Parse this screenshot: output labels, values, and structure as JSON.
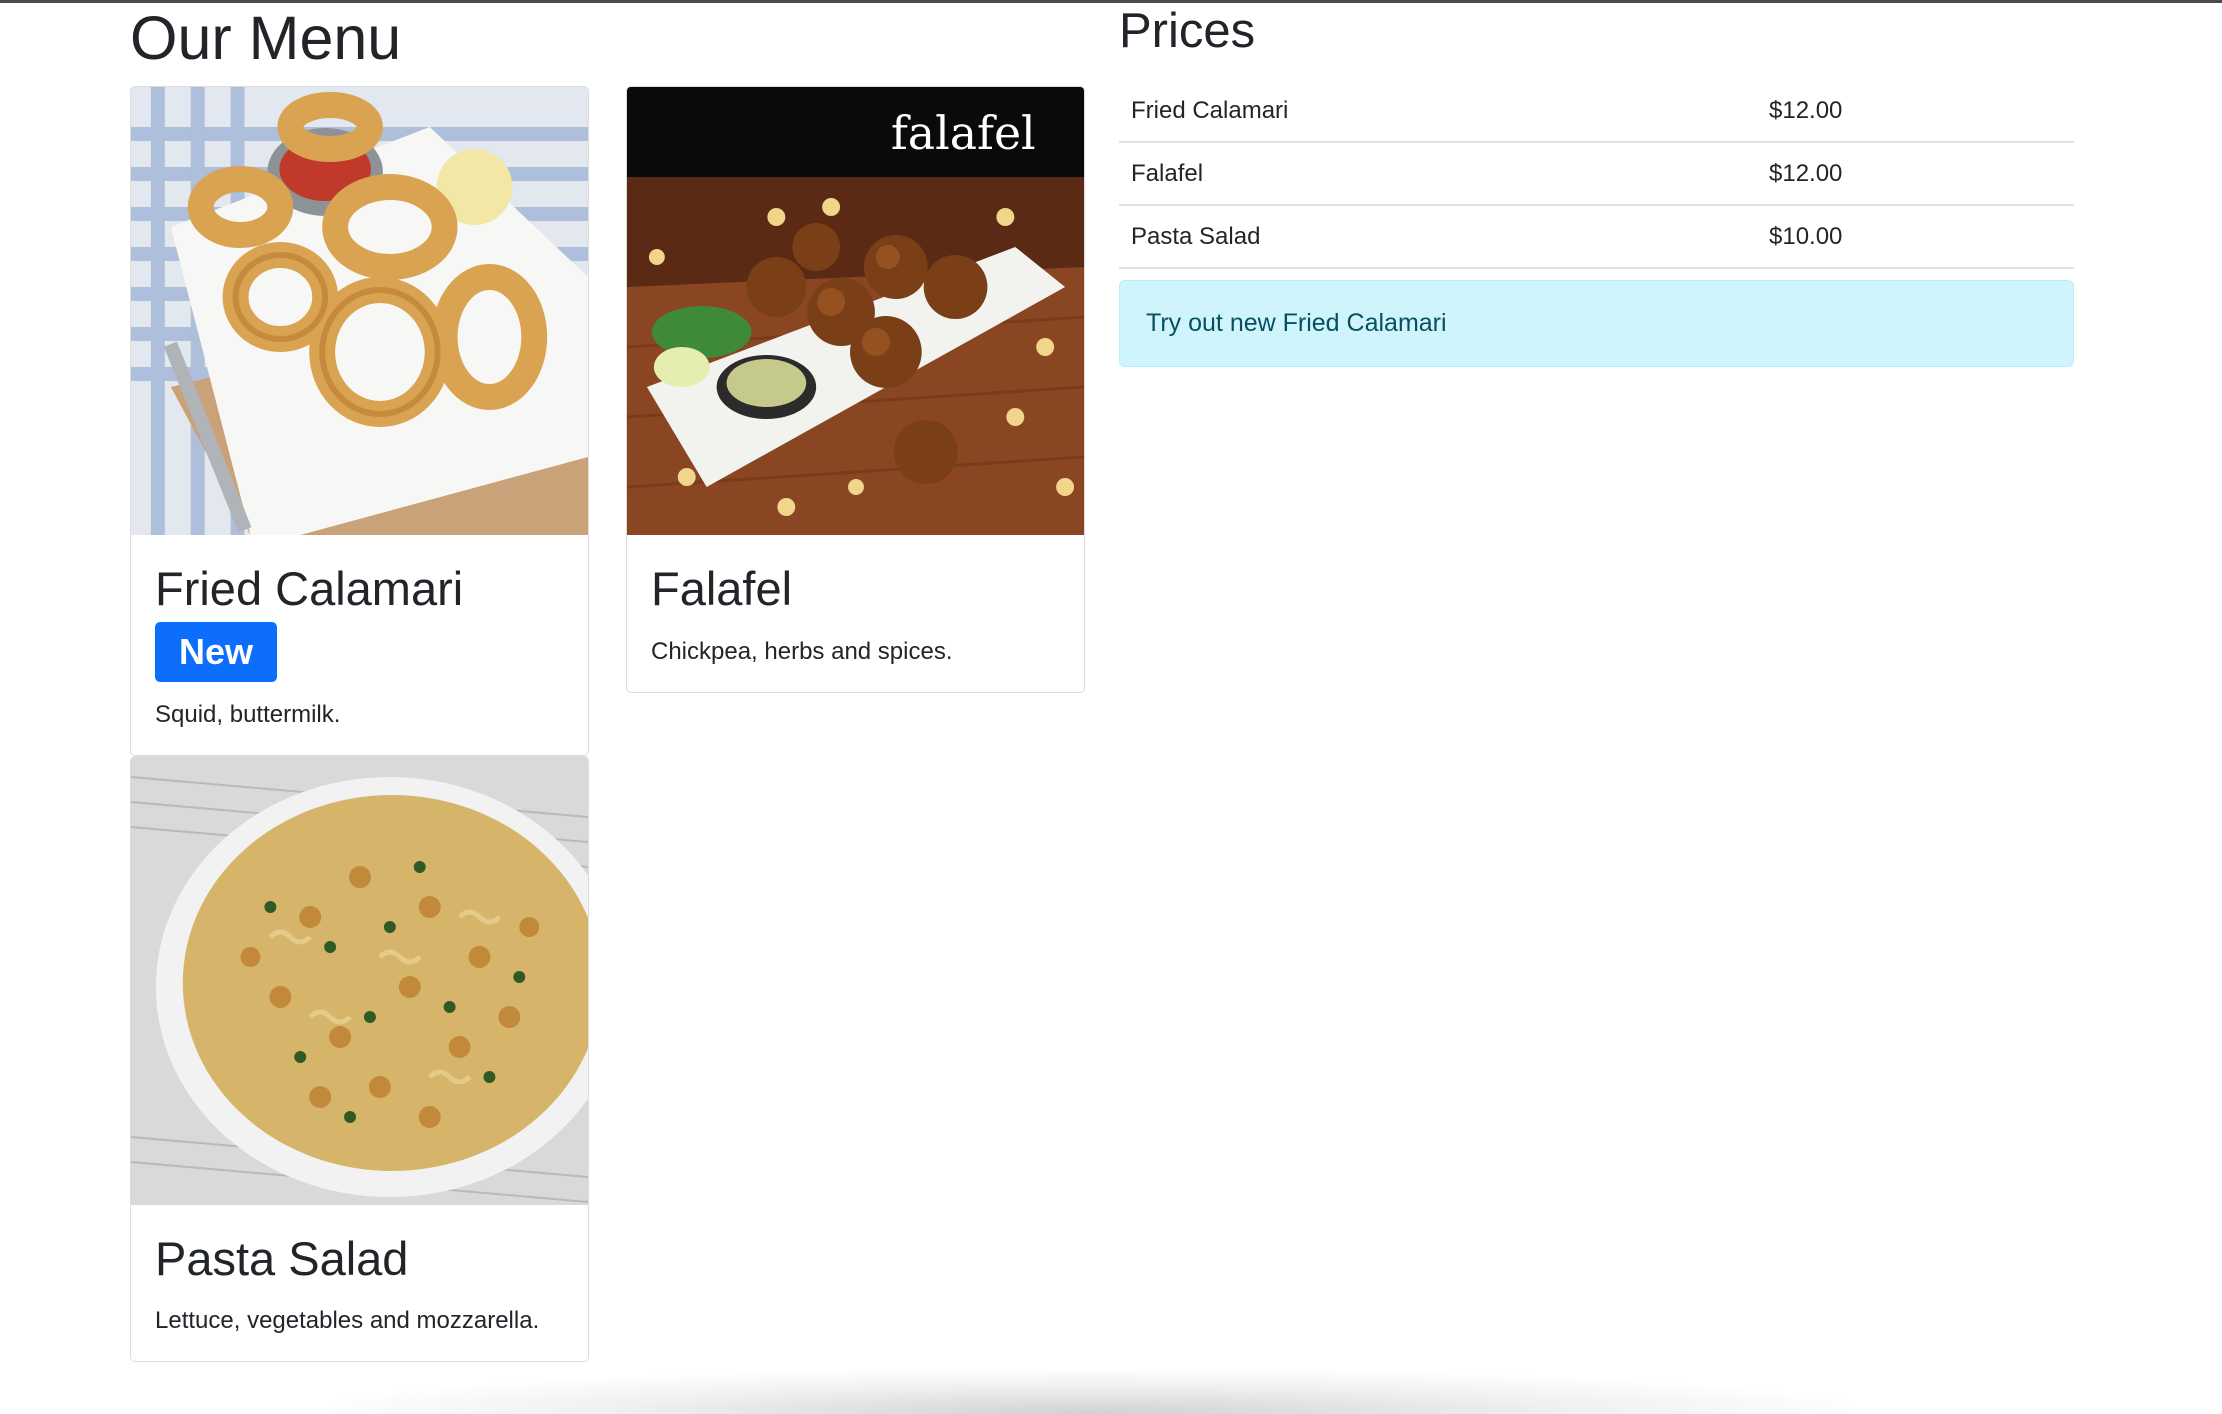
{
  "page": {
    "menu_heading": "Our Menu",
    "prices_heading": "Prices"
  },
  "colors": {
    "badge_bg": "#0d6efd",
    "alert_bg": "#cff4fc",
    "alert_text": "#055160",
    "text": "#212529"
  },
  "menu_items": [
    {
      "title": "Fried Calamari",
      "badge": "New",
      "description": "Squid, buttermilk.",
      "image": "fried-calamari-photo"
    },
    {
      "title": "Falafel",
      "description": "Chickpea, herbs and spices.",
      "image": "falafel-photo",
      "image_caption": "falafel"
    },
    {
      "title": "Pasta Salad",
      "description": "Lettuce, vegetables and mozzarella.",
      "image": "pasta-salad-photo"
    }
  ],
  "prices": [
    {
      "name": "Fried Calamari",
      "price": "$12.00"
    },
    {
      "name": "Falafel",
      "price": "$12.00"
    },
    {
      "name": "Pasta Salad",
      "price": "$10.00"
    }
  ],
  "alert": {
    "text": "Try out new Fried Calamari"
  }
}
